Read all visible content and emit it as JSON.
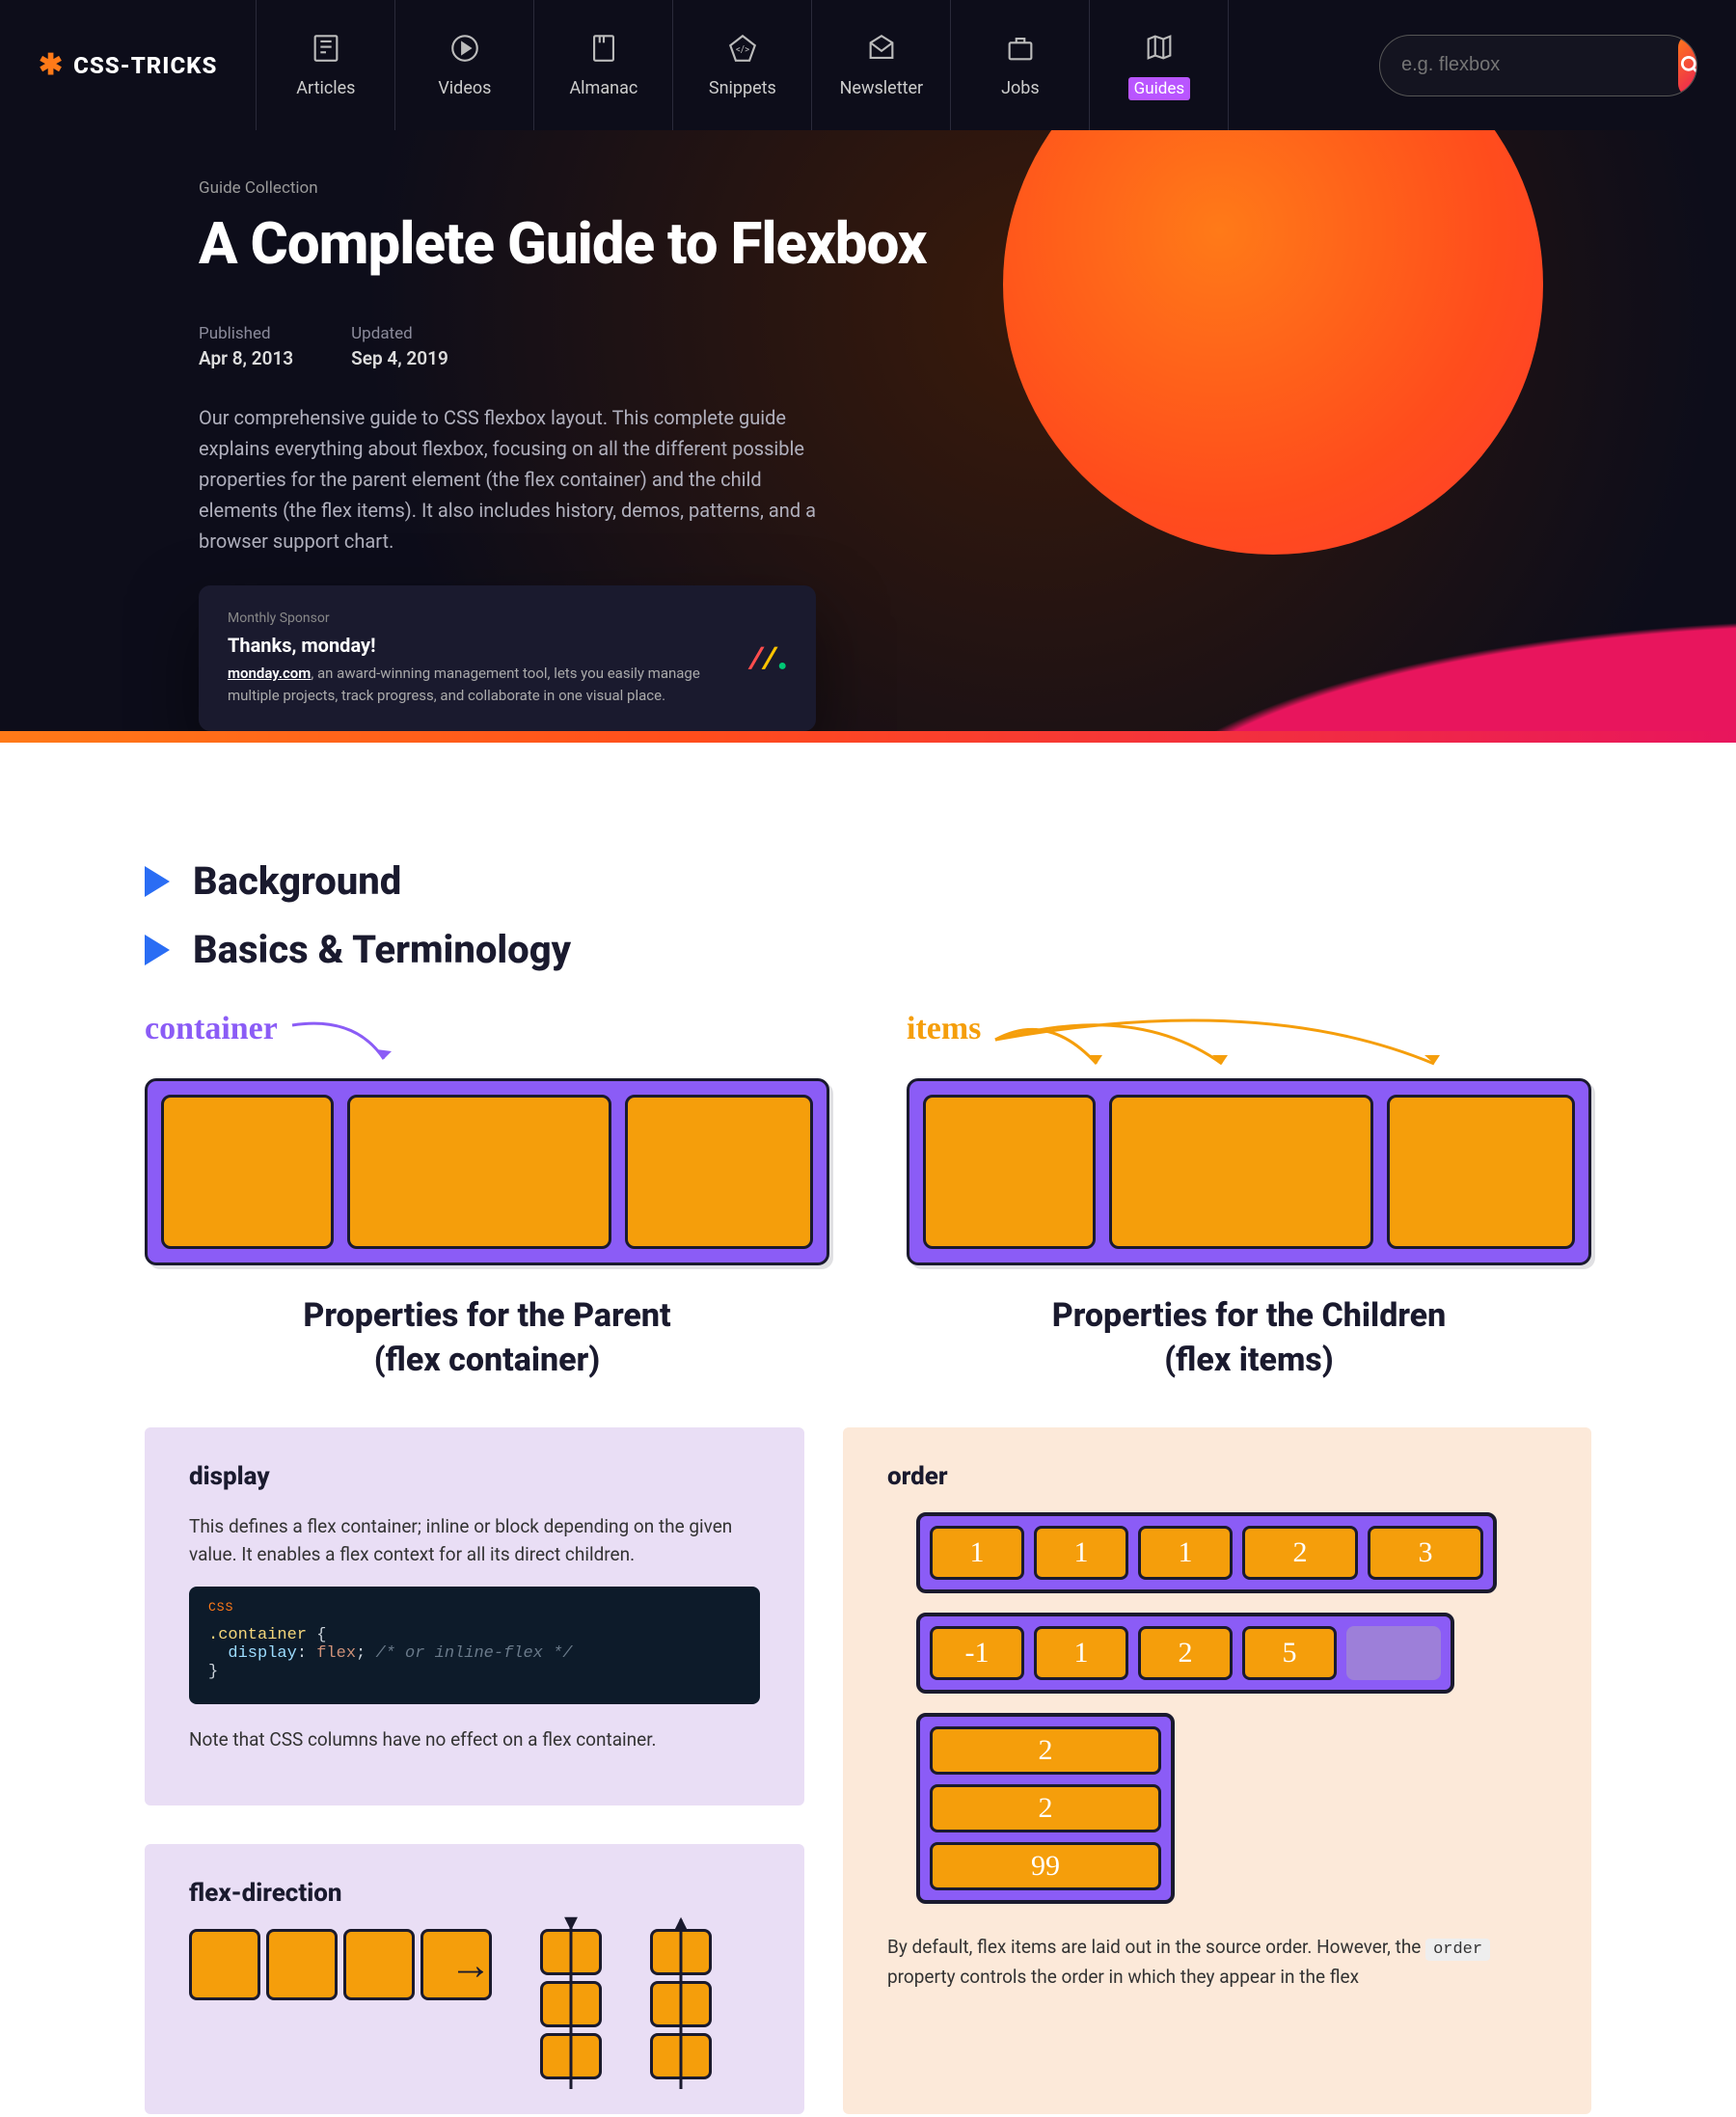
{
  "logo_text": "CSS-TRICKS",
  "nav": [
    {
      "label": "Articles"
    },
    {
      "label": "Videos"
    },
    {
      "label": "Almanac"
    },
    {
      "label": "Snippets"
    },
    {
      "label": "Newsletter"
    },
    {
      "label": "Jobs"
    },
    {
      "label": "Guides",
      "active": true
    }
  ],
  "search_placeholder": "e.g. flexbox",
  "hero": {
    "crumb": "Guide Collection",
    "title": "A Complete Guide to Flexbox",
    "published_label": "Published",
    "published_value": "Apr 8, 2013",
    "updated_label": "Updated",
    "updated_value": "Sep 4, 2019",
    "intro": "Our comprehensive guide to CSS flexbox layout. This complete guide explains everything about flexbox, focusing on all the different possible properties for the parent element (the flex container) and the child elements (the flex items). It also includes history, demos, patterns, and a browser support chart."
  },
  "sponsor": {
    "tiny": "Monthly Sponsor",
    "thanks": "Thanks, monday!",
    "link": "monday.com",
    "copy": ", an award-winning management tool, lets you easily manage multiple projects, track progress, and collaborate in one visual place."
  },
  "sections": {
    "background": "Background",
    "basics": "Basics & Terminology"
  },
  "diagram": {
    "container_label": "container",
    "items_label": "items",
    "parent_title_l1": "Properties for the Parent",
    "parent_title_l2": "(flex container)",
    "children_title_l1": "Properties for the Children",
    "children_title_l2": "(flex items)"
  },
  "display_card": {
    "heading": "display",
    "p1": "This defines a flex container; inline or block depending on the given value. It enables a flex context for all its direct children.",
    "code_lang": "CSS",
    "code_selector": ".container",
    "code_prop": "display",
    "code_val": "flex",
    "code_comment": "/* or inline-flex */",
    "p2": "Note that CSS columns have no effect on a flex container."
  },
  "flexdir_card": {
    "heading": "flex-direction"
  },
  "order_card": {
    "heading": "order",
    "row1": [
      "1",
      "1",
      "1",
      "2",
      "3"
    ],
    "row2": [
      "-1",
      "1",
      "2",
      "5",
      ""
    ],
    "col": [
      "2",
      "2",
      "99"
    ],
    "p1_a": "By default, flex items are laid out in the source order. However, the ",
    "p1_code": "order",
    "p1_b": " property controls the order in which they appear in the flex"
  }
}
